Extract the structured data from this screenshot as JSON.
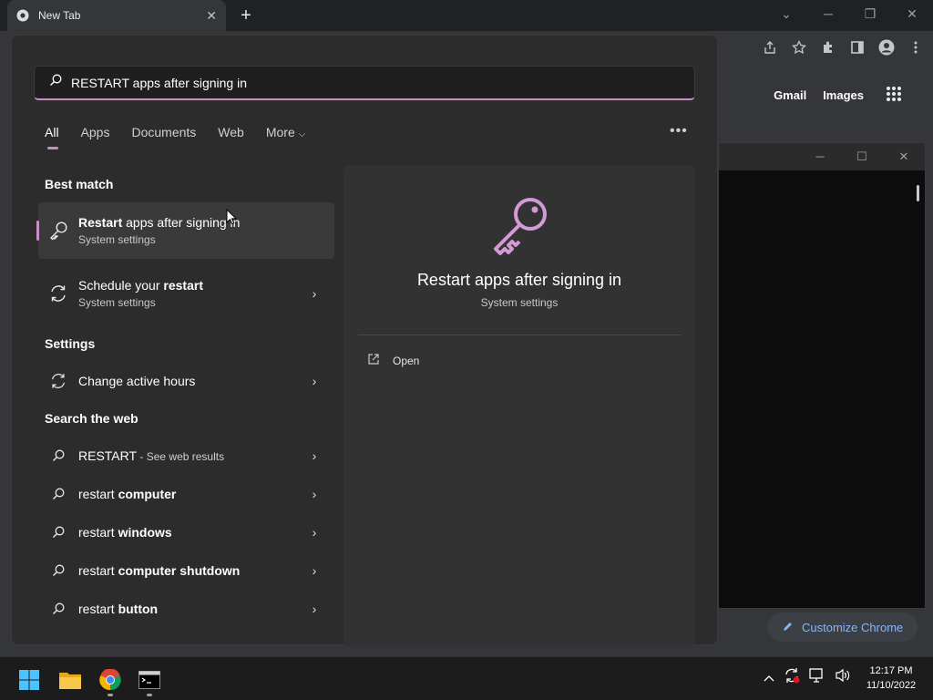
{
  "browser": {
    "tab_title": "New Tab",
    "links": [
      "Gmail",
      "Images"
    ],
    "customize_label": "Customize Chrome"
  },
  "search": {
    "query": "RESTART apps after signing in",
    "filters": [
      "All",
      "Apps",
      "Documents",
      "Web",
      "More"
    ],
    "sections": {
      "best_match": "Best match",
      "settings": "Settings",
      "search_web": "Search the web"
    },
    "best_match": [
      {
        "title_bold": "Restart",
        "title_rest": " apps after signing in",
        "subtitle": "System settings",
        "icon": "key-icon"
      },
      {
        "title_pre": "Schedule your ",
        "title_bold": "restart",
        "subtitle": "System settings",
        "icon": "refresh-icon"
      }
    ],
    "settings_items": [
      {
        "label": "Change active hours",
        "icon": "refresh-icon"
      }
    ],
    "web_items": [
      {
        "pre": "RESTART",
        "bold": "",
        "suffix": " - See web results"
      },
      {
        "pre": "restart ",
        "bold": "computer",
        "suffix": ""
      },
      {
        "pre": "restart ",
        "bold": "windows",
        "suffix": ""
      },
      {
        "pre": "restart ",
        "bold": "computer shutdown",
        "suffix": ""
      },
      {
        "pre": "restart ",
        "bold": "button",
        "suffix": ""
      }
    ],
    "preview": {
      "title": "Restart apps after signing in",
      "subtitle": "System settings",
      "open_label": "Open"
    },
    "accent_color": "#c88ec8"
  },
  "taskbar": {
    "apps": [
      "windows-start-icon",
      "file-explorer-icon",
      "chrome-icon",
      "terminal-icon"
    ],
    "time": "12:17 PM",
    "date": "11/10/2022"
  }
}
